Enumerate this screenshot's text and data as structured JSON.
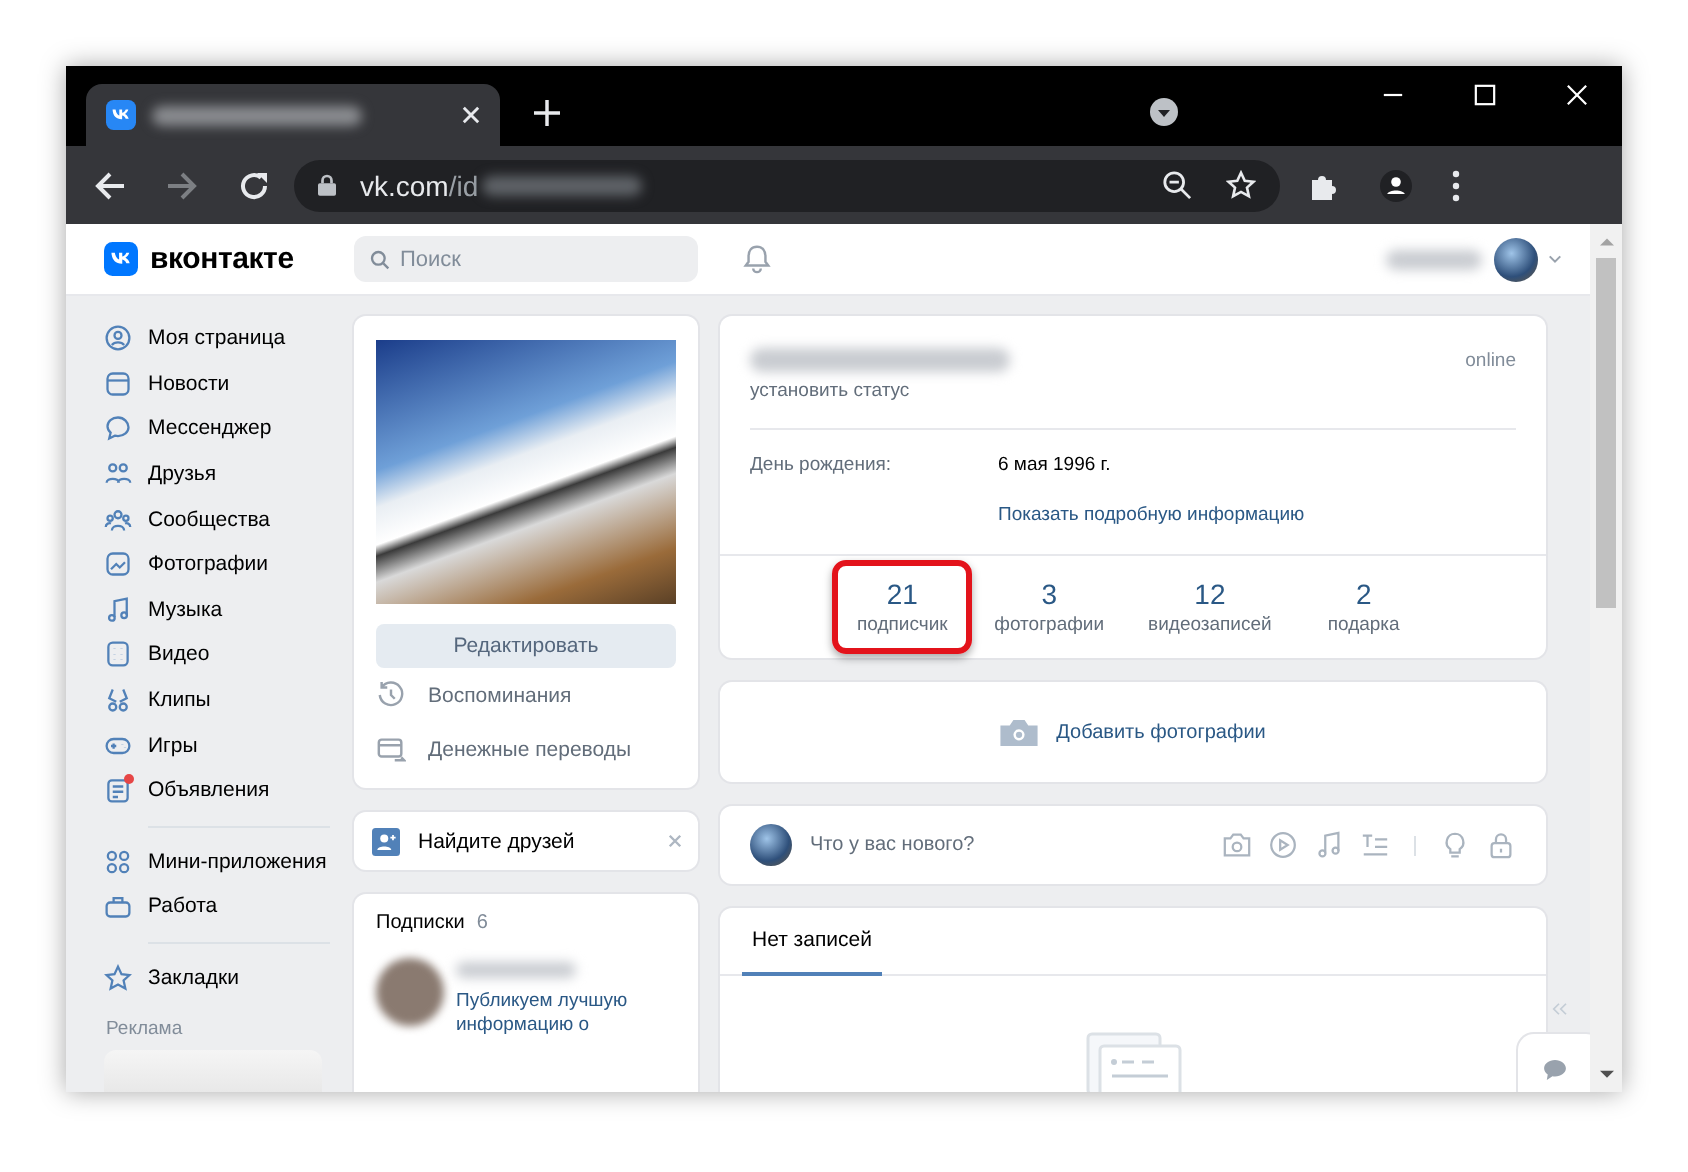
{
  "browser": {
    "url_host": "vk.com",
    "url_path": "/id"
  },
  "header": {
    "logo": "вконтакте",
    "search": {
      "placeholder": "Поиск"
    }
  },
  "sidebar": {
    "groups": [
      [
        {
          "label": "Моя страница",
          "has_dot": false
        },
        {
          "label": "Новости",
          "has_dot": false
        },
        {
          "label": "Мессенджер",
          "has_dot": false
        },
        {
          "label": "Друзья",
          "has_dot": false
        },
        {
          "label": "Сообщества",
          "has_dot": false
        },
        {
          "label": "Фотографии",
          "has_dot": false
        },
        {
          "label": "Музыка",
          "has_dot": false
        },
        {
          "label": "Видео",
          "has_dot": false
        },
        {
          "label": "Клипы",
          "has_dot": false
        },
        {
          "label": "Игры",
          "has_dot": false
        },
        {
          "label": "Объявления",
          "has_dot": true
        }
      ],
      [
        {
          "label": "Мини-приложения",
          "has_dot": false
        },
        {
          "label": "Работа",
          "has_dot": false
        }
      ],
      [
        {
          "label": "Закладки",
          "has_dot": false
        }
      ]
    ],
    "ad_label": "Реклама"
  },
  "profile": {
    "edit_button": "Редактировать",
    "actions": [
      "Воспоминания",
      "Денежные переводы"
    ]
  },
  "find_friends": {
    "label": "Найдите друзей"
  },
  "subscriptions": {
    "title": "Подписки",
    "count": "6",
    "items": [
      {
        "text": "Публикуем лучшую информацию о"
      }
    ]
  },
  "info": {
    "online": "online",
    "status": "установить статус",
    "fields": [
      {
        "label": "День рождения:",
        "value": "6 мая 1996 г."
      }
    ],
    "more_link": "Показать подробную информацию",
    "counters": [
      {
        "value": "21",
        "label": "подписчик",
        "highlighted": true
      },
      {
        "value": "3",
        "label": "фотографии",
        "highlighted": false
      },
      {
        "value": "12",
        "label": "видеозаписей",
        "highlighted": false
      },
      {
        "value": "2",
        "label": "подарка",
        "highlighted": false
      }
    ]
  },
  "add_photos": {
    "label": "Добавить фотографии"
  },
  "composer": {
    "placeholder": "Что у вас нового?"
  },
  "wall": {
    "tabs": [
      {
        "label": "Нет записей",
        "selected": true
      }
    ]
  }
}
